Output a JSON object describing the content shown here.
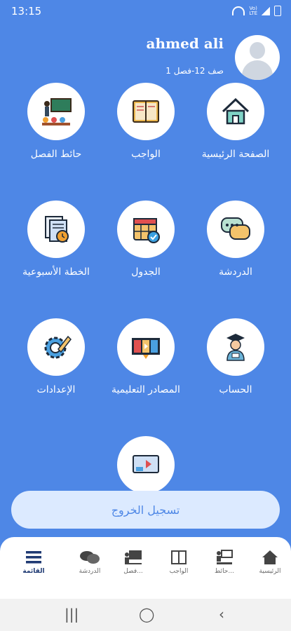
{
  "status_bar": {
    "time": "13:15",
    "icons": [
      "wifi-icon",
      "lte-icon",
      "signal-icon",
      "battery-icon"
    ]
  },
  "user": {
    "name": "ahmed ali",
    "class_label": "صف 12-فصل 1"
  },
  "tiles": [
    {
      "key": "home",
      "label": "الصفحة الرئيسية",
      "icon": "home-icon"
    },
    {
      "key": "homework",
      "label": "الواجب",
      "icon": "notebook-icon"
    },
    {
      "key": "class_wall",
      "label": "حائط الفصل",
      "icon": "classroom-icon"
    },
    {
      "key": "chat",
      "label": "الدردشة",
      "icon": "chat-bubbles-icon"
    },
    {
      "key": "schedule",
      "label": "الجدول",
      "icon": "calendar-icon"
    },
    {
      "key": "weekly_plan",
      "label": "الخطة الأسبوعية",
      "icon": "document-clock-icon"
    },
    {
      "key": "account",
      "label": "الحساب",
      "icon": "graduate-icon"
    },
    {
      "key": "resources",
      "label": "المصادر التعليمية",
      "icon": "media-resources-icon"
    },
    {
      "key": "settings",
      "label": "الإعدادات",
      "icon": "gear-pencil-icon"
    },
    {
      "key": "video",
      "label": "",
      "icon": "video-lesson-icon"
    }
  ],
  "logout_label": "تسجيل الخروج",
  "bottom_nav": [
    {
      "label": "الرئيسية",
      "icon": "home-icon"
    },
    {
      "label": "حائط...",
      "icon": "classroom-icon"
    },
    {
      "label": "الواجب",
      "icon": "book-icon"
    },
    {
      "label": "فصل...",
      "icon": "teacher-board-icon"
    },
    {
      "label": "الدردشة",
      "icon": "chat-icon"
    },
    {
      "label": "القائمة",
      "icon": "menu-icon",
      "active": true
    }
  ],
  "colors": {
    "background": "#4E87E6",
    "tile_bg": "#FFFFFF",
    "logout_bg": "#DCEAFF",
    "active_nav": "#1F3A73"
  }
}
